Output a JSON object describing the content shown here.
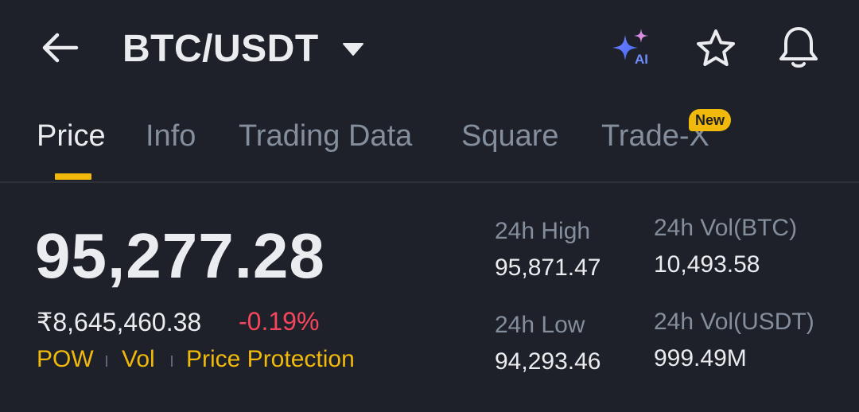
{
  "header": {
    "pair": "BTC/USDT",
    "icons": {
      "back": "arrow-left-icon",
      "caret": "caret-down-icon",
      "ai": "sparkles-ai-icon",
      "favorite": "star-icon",
      "alerts": "bell-icon"
    },
    "ai_label": "AI"
  },
  "tabs": [
    {
      "label": "Price",
      "active": true
    },
    {
      "label": "Info",
      "active": false
    },
    {
      "label": "Trading Data",
      "active": false
    },
    {
      "label": "Square",
      "active": false
    },
    {
      "label": "Trade-X",
      "active": false,
      "badge": "New"
    }
  ],
  "ticker": {
    "last_price": "95,277.28",
    "fiat_price": "₹8,645,460.38",
    "change_percent": "-0.19%",
    "tags": [
      "POW",
      "Vol",
      "Price Protection"
    ]
  },
  "stats": {
    "high_label": "24h High",
    "high_value": "95,871.47",
    "low_label": "24h Low",
    "low_value": "94,293.46",
    "vol_base_label": "24h Vol(BTC)",
    "vol_base_value": "10,493.58",
    "vol_quote_label": "24h Vol(USDT)",
    "vol_quote_value": "999.49M"
  },
  "colors": {
    "background": "#1e2129",
    "primary_text": "#eaecef",
    "secondary_text": "#848e9c",
    "accent": "#f0b90b",
    "negative": "#f6465d"
  }
}
